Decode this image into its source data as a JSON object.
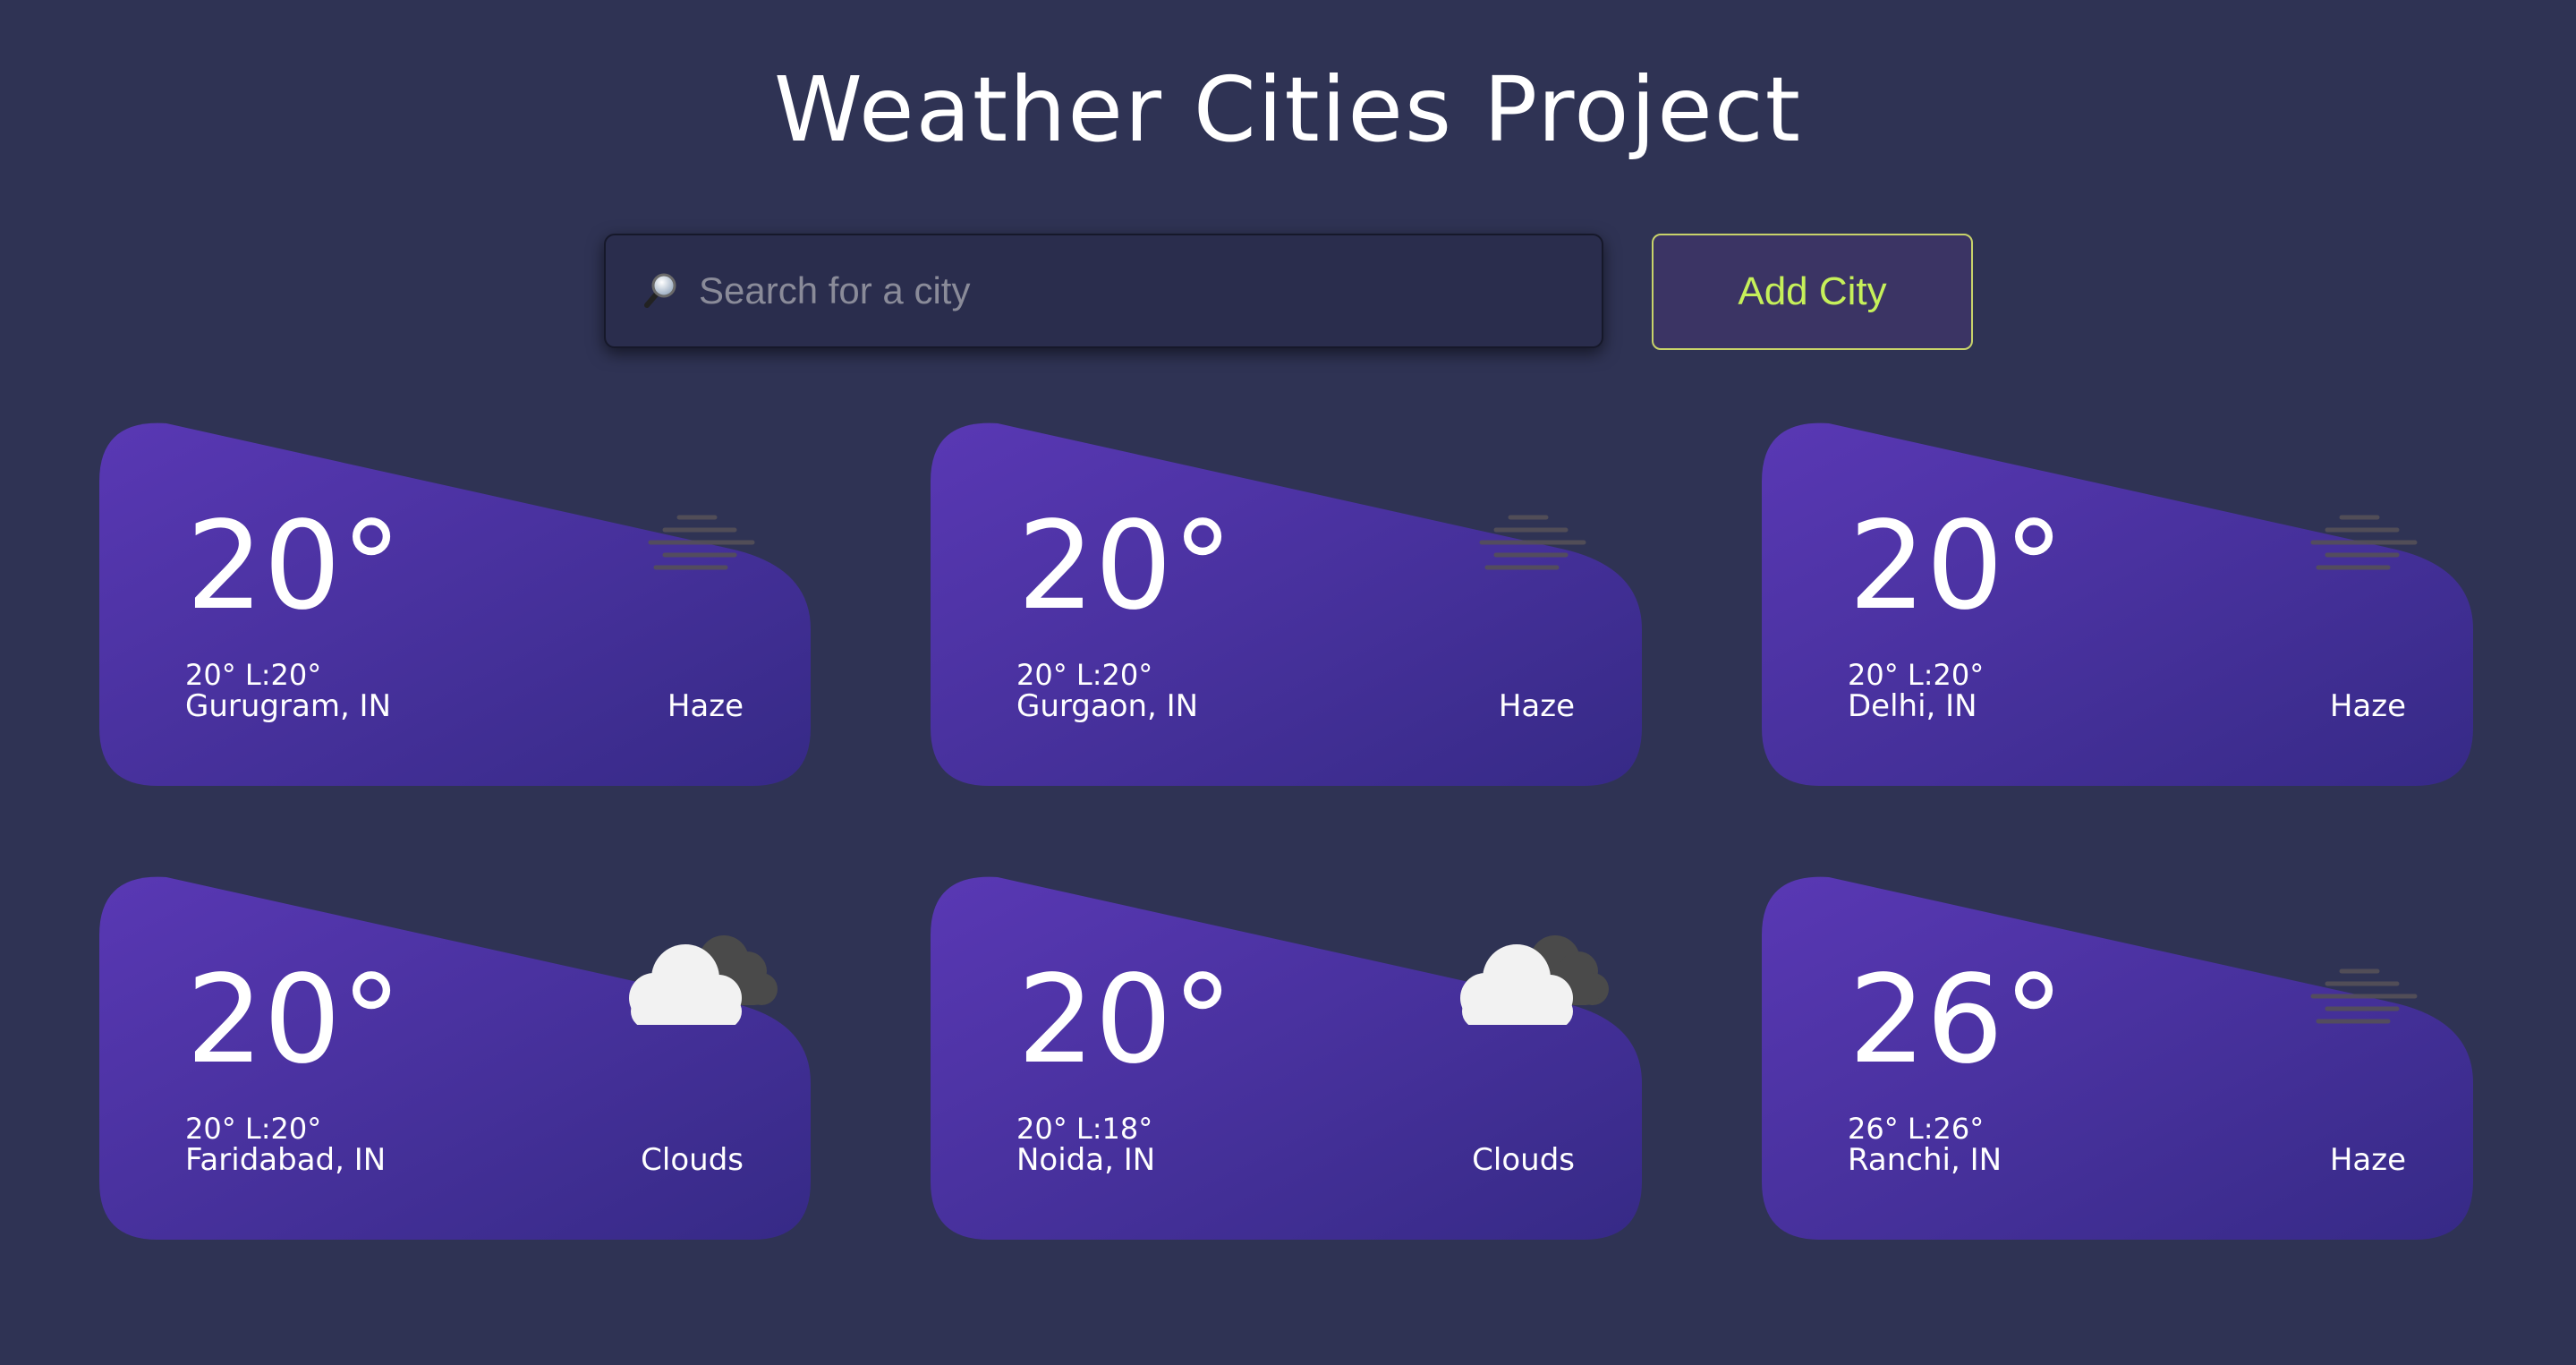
{
  "page": {
    "title": "Weather Cities Project",
    "background_color": "#2f3354"
  },
  "search": {
    "placeholder": "Search for a city",
    "value": "",
    "icon": "magnifier-icon"
  },
  "add_button": {
    "label": "Add City",
    "text_color": "#c6f05a",
    "border_color": "#c8d36a"
  },
  "card_style": {
    "gradient_start": "#5938b4",
    "gradient_end": "#362a86"
  },
  "cards": [
    {
      "temp": "20°",
      "hilo": "20° L:20°",
      "city": "Gurugram, IN",
      "condition": "Haze",
      "icon": "haze-icon"
    },
    {
      "temp": "20°",
      "hilo": "20° L:20°",
      "city": "Gurgaon, IN",
      "condition": "Haze",
      "icon": "haze-icon"
    },
    {
      "temp": "20°",
      "hilo": "20° L:20°",
      "city": "Delhi, IN",
      "condition": "Haze",
      "icon": "haze-icon"
    },
    {
      "temp": "20°",
      "hilo": "20° L:20°",
      "city": "Faridabad, IN",
      "condition": "Clouds",
      "icon": "clouds-icon"
    },
    {
      "temp": "20°",
      "hilo": "20° L:18°",
      "city": "Noida, IN",
      "condition": "Clouds",
      "icon": "clouds-icon"
    },
    {
      "temp": "26°",
      "hilo": "26° L:26°",
      "city": "Ranchi, IN",
      "condition": "Haze",
      "icon": "haze-icon"
    }
  ]
}
